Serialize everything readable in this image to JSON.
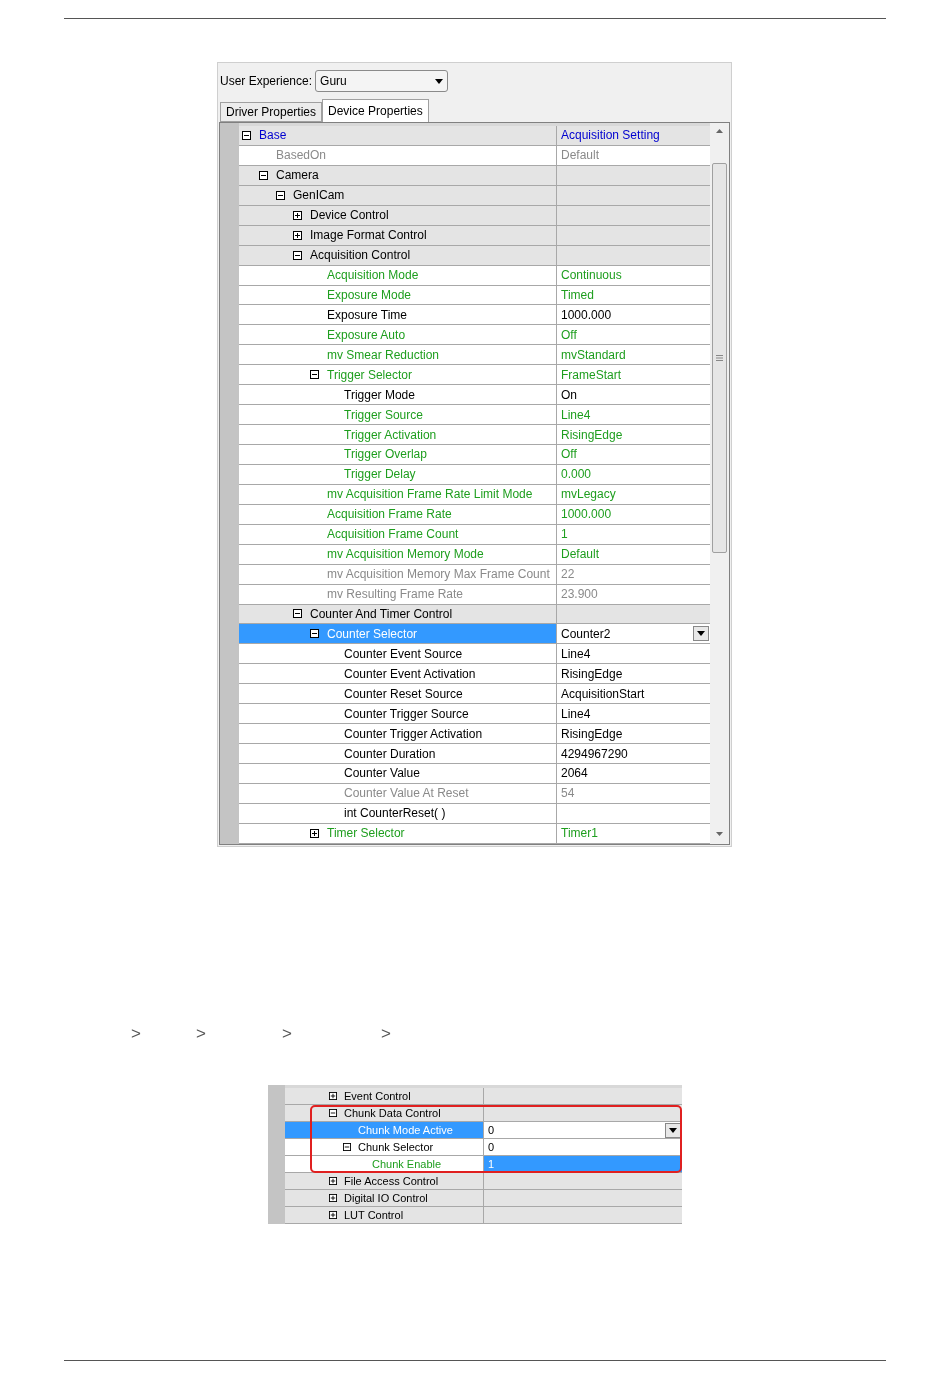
{
  "property_window": {
    "user_experience": {
      "label": "User Experience:",
      "value": "Guru"
    },
    "tabs": [
      {
        "label": "Driver Properties",
        "selected": false
      },
      {
        "label": "Device Properties",
        "selected": true
      }
    ],
    "rows": [
      {
        "name": "Base",
        "value": "Acquisition Setting",
        "kind": "category",
        "color": "#0000d0",
        "selected": false,
        "expanded": true,
        "children": [
          {
            "name": "BasedOn",
            "value": "Default",
            "kind": "property",
            "color": "#8a8a8a",
            "selected": false
          },
          {
            "name": "Camera",
            "kind": "category",
            "color": "#000000",
            "selected": false,
            "expanded": true,
            "children": [
              {
                "name": "GenICam",
                "kind": "category",
                "color": "#000000",
                "selected": false,
                "expanded": true,
                "children": [
                  {
                    "name": "Device Control",
                    "kind": "category",
                    "color": "#000000",
                    "selected": false,
                    "expanded": false
                  },
                  {
                    "name": "Image Format Control",
                    "kind": "category",
                    "color": "#000000",
                    "selected": false,
                    "expanded": false
                  },
                  {
                    "name": "Acquisition Control",
                    "kind": "category",
                    "color": "#000000",
                    "selected": false,
                    "expanded": true,
                    "children": [
                      {
                        "name": "Acquisition Mode",
                        "value": "Continuous",
                        "kind": "property",
                        "color": "#1e9e1e",
                        "selected": false
                      },
                      {
                        "name": "Exposure Mode",
                        "value": "Timed",
                        "kind": "property",
                        "color": "#1e9e1e",
                        "selected": false
                      },
                      {
                        "name": "Exposure Time",
                        "value": "1000.000",
                        "kind": "property",
                        "color": "#000000",
                        "selected": false
                      },
                      {
                        "name": "Exposure Auto",
                        "value": "Off",
                        "kind": "property",
                        "color": "#1e9e1e",
                        "selected": false
                      },
                      {
                        "name": "mv Smear Reduction",
                        "value": "mvStandard",
                        "kind": "property",
                        "color": "#1e9e1e",
                        "selected": false
                      },
                      {
                        "name": "Trigger Selector",
                        "value": "FrameStart",
                        "kind": "property",
                        "color": "#1e9e1e",
                        "selected": false,
                        "expanded": true,
                        "children": [
                          {
                            "name": "Trigger Mode",
                            "value": "On",
                            "kind": "property",
                            "color": "#000000",
                            "selected": false
                          },
                          {
                            "name": "Trigger Source",
                            "value": "Line4",
                            "kind": "property",
                            "color": "#1e9e1e",
                            "selected": false
                          },
                          {
                            "name": "Trigger Activation",
                            "value": "RisingEdge",
                            "kind": "property",
                            "color": "#1e9e1e",
                            "selected": false
                          },
                          {
                            "name": "Trigger Overlap",
                            "value": "Off",
                            "kind": "property",
                            "color": "#1e9e1e",
                            "selected": false
                          },
                          {
                            "name": "Trigger Delay",
                            "value": "0.000",
                            "kind": "property",
                            "color": "#1e9e1e",
                            "selected": false
                          }
                        ]
                      },
                      {
                        "name": "mv Acquisition Frame Rate Limit Mode",
                        "value": "mvLegacy",
                        "kind": "property",
                        "color": "#1e9e1e",
                        "selected": false
                      },
                      {
                        "name": "Acquisition Frame Rate",
                        "value": "1000.000",
                        "kind": "property",
                        "color": "#1e9e1e",
                        "selected": false
                      },
                      {
                        "name": "Acquisition Frame Count",
                        "value": "1",
                        "kind": "property",
                        "color": "#1e9e1e",
                        "selected": false
                      },
                      {
                        "name": "mv Acquisition Memory Mode",
                        "value": "Default",
                        "kind": "property",
                        "color": "#1e9e1e",
                        "selected": false
                      },
                      {
                        "name": "mv Acquisition Memory Max Frame Count",
                        "value": "22",
                        "kind": "property",
                        "color": "#8a8a8a",
                        "selected": false
                      },
                      {
                        "name": "mv Resulting Frame Rate",
                        "value": "23.900",
                        "kind": "property",
                        "color": "#8a8a8a",
                        "selected": false
                      }
                    ]
                  },
                  {
                    "name": "Counter And Timer Control",
                    "kind": "category",
                    "color": "#000000",
                    "selected": false,
                    "expanded": true,
                    "children": [
                      {
                        "name": "Counter Selector",
                        "value": "Counter2",
                        "kind": "property",
                        "selected": true,
                        "expanded": true,
                        "children": [
                          {
                            "name": "Counter Event Source",
                            "value": "Line4",
                            "kind": "property",
                            "color": "#000000",
                            "selected": false
                          },
                          {
                            "name": "Counter Event Activation",
                            "value": "RisingEdge",
                            "kind": "property",
                            "color": "#000000",
                            "selected": false
                          },
                          {
                            "name": "Counter Reset Source",
                            "value": "AcquisitionStart",
                            "kind": "property",
                            "color": "#000000",
                            "selected": false
                          },
                          {
                            "name": "Counter Trigger Source",
                            "value": "Line4",
                            "kind": "property",
                            "color": "#000000",
                            "selected": false
                          },
                          {
                            "name": "Counter Trigger Activation",
                            "value": "RisingEdge",
                            "kind": "property",
                            "color": "#000000",
                            "selected": false
                          },
                          {
                            "name": "Counter Duration",
                            "value": "4294967290",
                            "kind": "property",
                            "color": "#000000",
                            "selected": false
                          },
                          {
                            "name": "Counter Value",
                            "value": "2064",
                            "kind": "property",
                            "color": "#000000",
                            "selected": false
                          },
                          {
                            "name": "Counter Value At Reset",
                            "value": "54",
                            "kind": "property",
                            "color": "#8a8a8a",
                            "selected": false
                          },
                          {
                            "name": "int CounterReset( )",
                            "kind": "property",
                            "color": "#000000",
                            "selected": false
                          }
                        ]
                      },
                      {
                        "name": "Timer Selector",
                        "value": "Timer1",
                        "kind": "property",
                        "color": "#1e9e1e",
                        "selected": false,
                        "expanded": false
                      }
                    ]
                  }
                ]
              }
            ]
          }
        ]
      }
    ]
  },
  "breadcrumb_separators": [
    ">",
    ">",
    ">",
    ">"
  ],
  "chunk_window": {
    "rows": [
      {
        "name": "Event Control",
        "kind": "category",
        "color": "#000000",
        "selected": false,
        "expanded": false,
        "outlined": false,
        "value_selected": false
      },
      {
        "name": "Chunk Data Control",
        "kind": "category",
        "color": "#000000",
        "selected": false,
        "expanded": true,
        "outlined": true,
        "value_selected": false,
        "children": [
          {
            "name": "Chunk Mode Active",
            "value": "0",
            "kind": "property",
            "selected": true,
            "value_selected": false
          },
          {
            "name": "Chunk Selector",
            "value": "0",
            "kind": "property",
            "color": "#000000",
            "selected": false,
            "expanded": true,
            "value_selected": false,
            "children": [
              {
                "name": "Chunk Enable",
                "value": "1",
                "kind": "property",
                "color": "#1e9e1e",
                "selected": false,
                "value_selected": true
              }
            ]
          }
        ]
      },
      {
        "name": "File Access Control",
        "kind": "category",
        "color": "#000000",
        "selected": false,
        "expanded": false,
        "outlined": false,
        "value_selected": false
      },
      {
        "name": "Digital IO Control",
        "kind": "category",
        "color": "#000000",
        "selected": false,
        "expanded": false,
        "outlined": false,
        "value_selected": false
      },
      {
        "name": "LUT Control",
        "kind": "category",
        "color": "#000000",
        "selected": false,
        "expanded": false,
        "outlined": false,
        "value_selected": false
      }
    ]
  }
}
